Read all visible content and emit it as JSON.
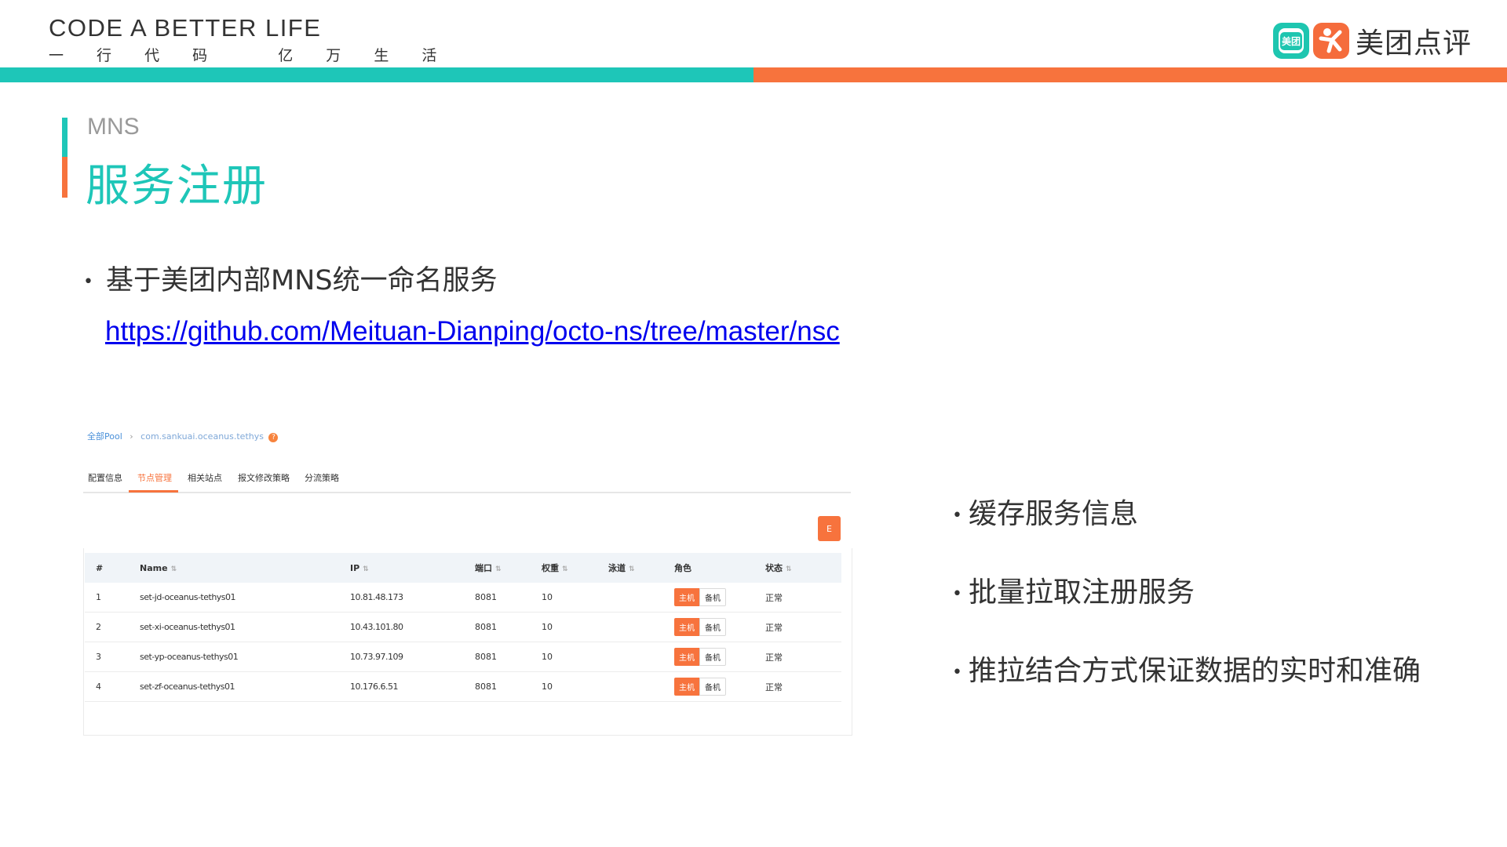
{
  "header": {
    "slogan_en": "CODE A BETTER LIFE",
    "slogan_cn": "一 行 代 码   亿 万 生 活",
    "brand_badge": "美团",
    "brand_name": "美团点评"
  },
  "colors": {
    "teal": "#1ec6b8",
    "orange": "#f7733d"
  },
  "title": {
    "kicker": "MNS",
    "main": "服务注册"
  },
  "bullets": {
    "main": "基于美团内部MNS统一命名服务",
    "link": "https://github.com/Meituan-Dianping/octo-ns/tree/master/nsc",
    "side": [
      "缓存服务信息",
      "批量拉取注册服务",
      "推拉结合方式保证数据的实时和准确"
    ],
    "dot": "•"
  },
  "screenshot": {
    "breadcrumb": {
      "root": "全部Pool",
      "current": "com.sankuai.oceanus.tethys"
    },
    "tabs": [
      "配置信息",
      "节点管理",
      "相关站点",
      "报文修改策略",
      "分流策略"
    ],
    "active_tab": "节点管理",
    "export_label": "E",
    "table": {
      "headers": [
        "#",
        "Name",
        "IP",
        "端口",
        "权重",
        "泳道",
        "角色",
        "状态"
      ],
      "rows": [
        {
          "idx": "1",
          "name": "set-jd-oceanus-tethys01",
          "ip": "10.81.48.173",
          "port": "8081",
          "weight": "10",
          "lane": "",
          "role_main": "主机",
          "role_backup": "备机",
          "status": "正常"
        },
        {
          "idx": "2",
          "name": "set-xi-oceanus-tethys01",
          "ip": "10.43.101.80",
          "port": "8081",
          "weight": "10",
          "lane": "",
          "role_main": "主机",
          "role_backup": "备机",
          "status": "正常"
        },
        {
          "idx": "3",
          "name": "set-yp-oceanus-tethys01",
          "ip": "10.73.97.109",
          "port": "8081",
          "weight": "10",
          "lane": "",
          "role_main": "主机",
          "role_backup": "备机",
          "status": "正常"
        },
        {
          "idx": "4",
          "name": "set-zf-oceanus-tethys01",
          "ip": "10.176.6.51",
          "port": "8081",
          "weight": "10",
          "lane": "",
          "role_main": "主机",
          "role_backup": "备机",
          "status": "正常"
        }
      ]
    }
  }
}
